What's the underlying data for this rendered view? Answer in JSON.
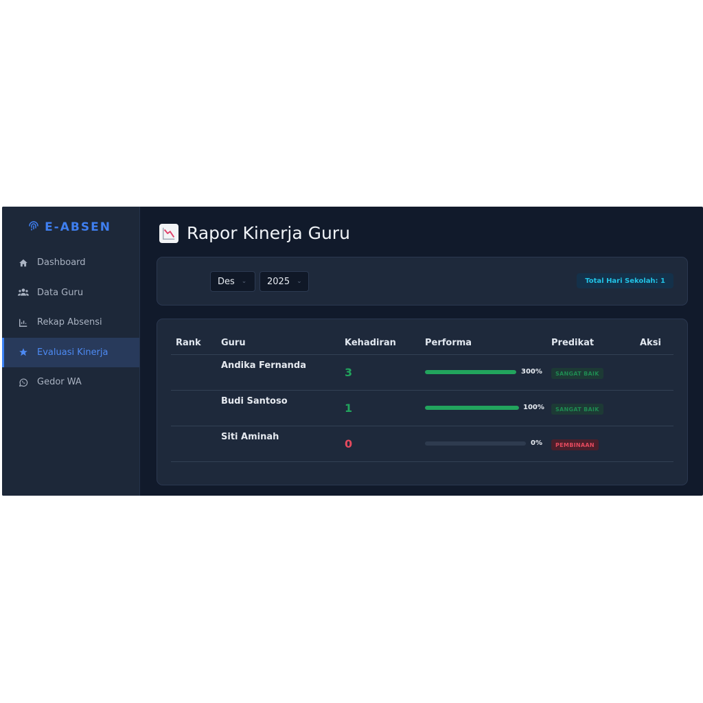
{
  "brand": {
    "name": "E-ABSEN",
    "icon": "fingerprint-icon"
  },
  "sidebar": {
    "items": [
      {
        "label": "Dashboard",
        "icon": "home-icon"
      },
      {
        "label": "Data Guru",
        "icon": "users-icon"
      },
      {
        "label": "Rekap Absensi",
        "icon": "chart-bar-icon"
      },
      {
        "label": "Evaluasi Kinerja",
        "icon": "star-icon",
        "active": true
      },
      {
        "label": "Gedor WA",
        "icon": "whatsapp-icon"
      }
    ]
  },
  "page": {
    "title": "Rapor Kinerja Guru",
    "icon": "chart-decreasing-icon"
  },
  "filter": {
    "month": "Des",
    "year": "2025",
    "total_days": "Total Hari Sekolah: 1"
  },
  "table": {
    "headers": [
      "Rank",
      "Guru",
      "Kehadiran",
      "Performa",
      "Predikat",
      "Aksi"
    ],
    "rows": [
      {
        "name": "Andika Fernanda",
        "attendance": "3",
        "performance": "300%",
        "performance_fill": 1.0,
        "predicate": "SANGAT BAIK",
        "status": "good"
      },
      {
        "name": "Budi Santoso",
        "attendance": "1",
        "performance": "100%",
        "performance_fill": 1.0,
        "predicate": "SANGAT BAIK",
        "status": "good"
      },
      {
        "name": "Siti Aminah",
        "attendance": "0",
        "performance": "0%",
        "performance_fill": 0.0,
        "predicate": "PEMBINAAN",
        "status": "bad"
      }
    ]
  },
  "colors": {
    "accent": "#3b82f6",
    "good": "#22a45d",
    "bad": "#e54a5e",
    "info": "#22c3e6"
  }
}
